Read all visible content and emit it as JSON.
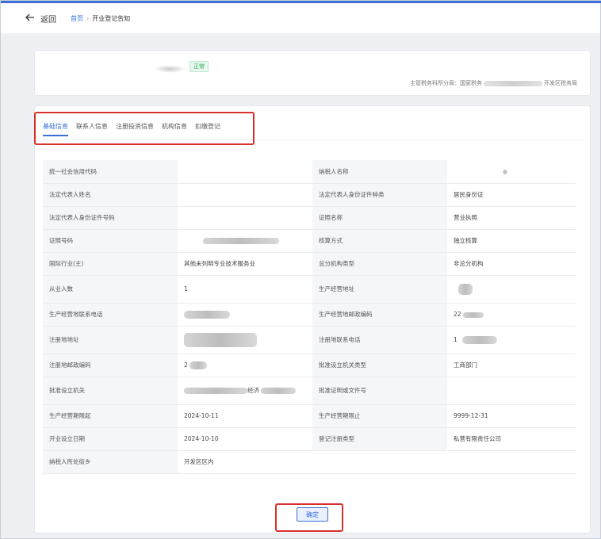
{
  "nav": {
    "back_label": "返回",
    "home_label": "首页",
    "separator": "›",
    "page_title": "开业登记告知"
  },
  "summary": {
    "status_badge": "正常",
    "authority_prefix": "主管税务科所分局：国家税务",
    "authority_suffix": "开发区税务局"
  },
  "tabs": [
    {
      "label": "基础信息",
      "active": true
    },
    {
      "label": "联系人信息",
      "active": false
    },
    {
      "label": "注册投资信息",
      "active": false
    },
    {
      "label": "机构信息",
      "active": false
    },
    {
      "label": "扣缴登记",
      "active": false
    }
  ],
  "rows": [
    {
      "l1": "统一社会信用代码",
      "v1": "",
      "l2": "纳税人名称",
      "v2": ""
    },
    {
      "l1": "法定代表人姓名",
      "v1": "",
      "l2": "法定代表人身份证件种类",
      "v2": "居民身份证"
    },
    {
      "l1": "法定代表人身份证件号码",
      "v1": "",
      "l2": "证照名称",
      "v2": "营业执照"
    },
    {
      "l1": "证照号码",
      "v1": "",
      "l2": "核算方式",
      "v2": "独立核算"
    },
    {
      "l1": "国际行业(主)",
      "v1": "其他未列明专业技术服务业",
      "l2": "总分机构类型",
      "v2": "非总分机构"
    },
    {
      "l1": "从业人数",
      "v1": "1",
      "l2": "生产经营地址",
      "v2": ""
    },
    {
      "l1": "生产经营地联系电话",
      "v1": "",
      "l2": "生产经营地邮政编码",
      "v2": "22"
    },
    {
      "l1": "注册地地址",
      "v1": "",
      "l2": "注册地联系电话",
      "v2": "1"
    },
    {
      "l1": "注册地邮政编码",
      "v1": "2",
      "l2": "批准设立机关类型",
      "v2": "工商部门"
    },
    {
      "l1": "批准设立机关",
      "v1": "经济",
      "l2": "批准证明或文件号",
      "v2": ""
    },
    {
      "l1": "生产经营期限起",
      "v1": "2024-10-11",
      "l2": "生产经营期限止",
      "v2": "9999-12-31"
    },
    {
      "l1": "开业设立日期",
      "v1": "2024-10-10",
      "l2": "登记注册类型",
      "v2": "私营有限责任公司"
    },
    {
      "l1": "纳税人所处街乡",
      "v1": "开发区区内",
      "l2": "",
      "v2": ""
    }
  ],
  "confirm_label": "确定",
  "colors": {
    "accent": "#3a6fd8",
    "highlight_box": "#d8302b",
    "badge_green": "#26a65b"
  }
}
